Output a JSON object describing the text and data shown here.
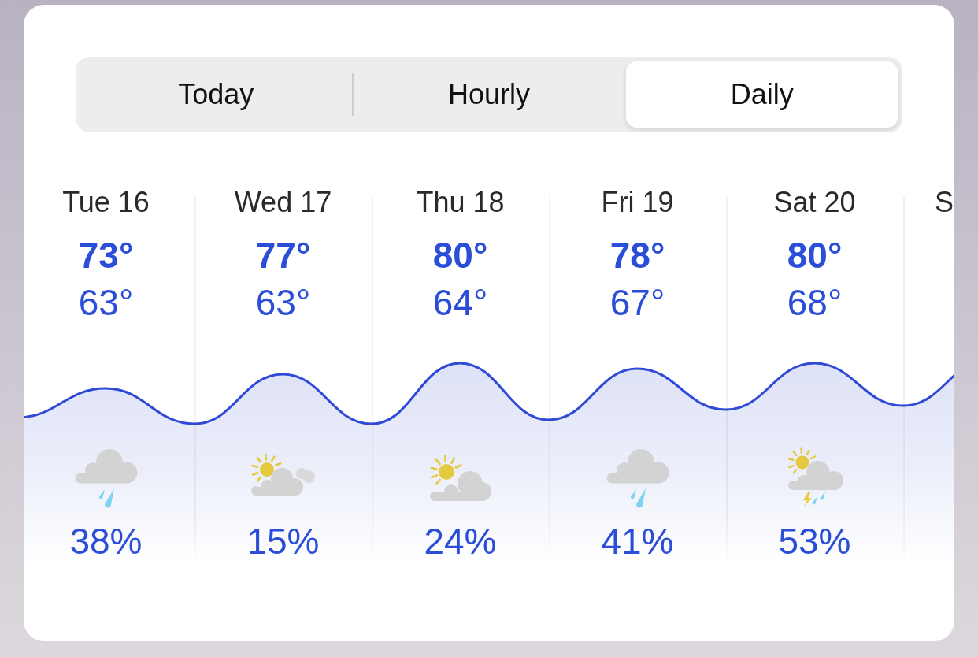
{
  "tabs": [
    {
      "label": "Today",
      "selected": false
    },
    {
      "label": "Hourly",
      "selected": false
    },
    {
      "label": "Daily",
      "selected": true
    }
  ],
  "days": [
    {
      "day": "Tue 16",
      "high": "73°",
      "low": "63°",
      "kind": "rain",
      "precip": "38%"
    },
    {
      "day": "Wed 17",
      "high": "77°",
      "low": "63°",
      "kind": "sun-clouds",
      "precip": "15%"
    },
    {
      "day": "Thu 18",
      "high": "80°",
      "low": "64°",
      "kind": "sun-cloud",
      "precip": "24%"
    },
    {
      "day": "Fri 19",
      "high": "78°",
      "low": "67°",
      "kind": "rain",
      "precip": "41%"
    },
    {
      "day": "Sat 20",
      "high": "80°",
      "low": "68°",
      "kind": "sun-storm",
      "precip": "53%"
    },
    {
      "day": "S"
    }
  ]
}
